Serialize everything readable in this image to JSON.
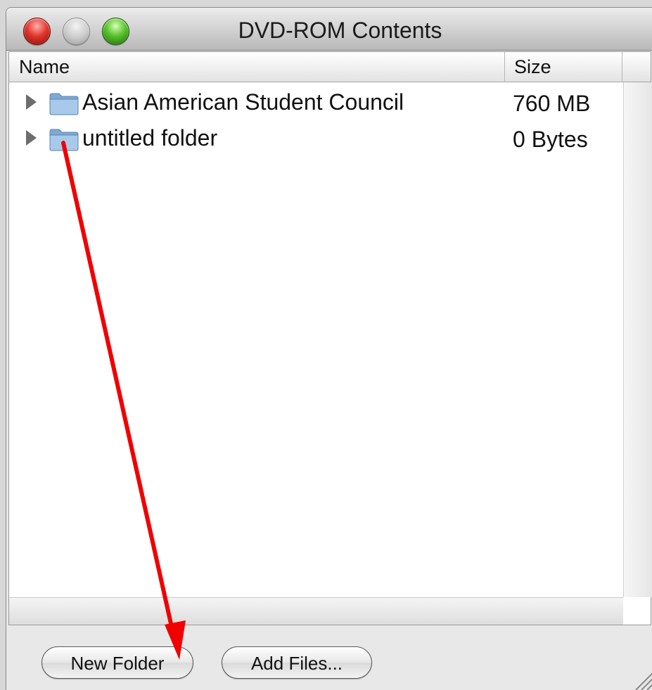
{
  "window": {
    "title": "DVD-ROM Contents"
  },
  "columns": {
    "name": "Name",
    "size": "Size"
  },
  "rows": [
    {
      "name": "Asian American Student Council",
      "size": "760 MB",
      "icon": "folder-icon"
    },
    {
      "name": "untitled folder",
      "size": "0 Bytes",
      "icon": "folder-icon"
    }
  ],
  "buttons": {
    "new_folder": "New Folder",
    "add_files": "Add Files..."
  },
  "annotation": {
    "arrow_color": "#f00000"
  },
  "colors": {
    "close": "#e2362d",
    "minimize": "#c9c9c9",
    "zoom": "#58c12c",
    "folder": "#8fb8e0"
  }
}
